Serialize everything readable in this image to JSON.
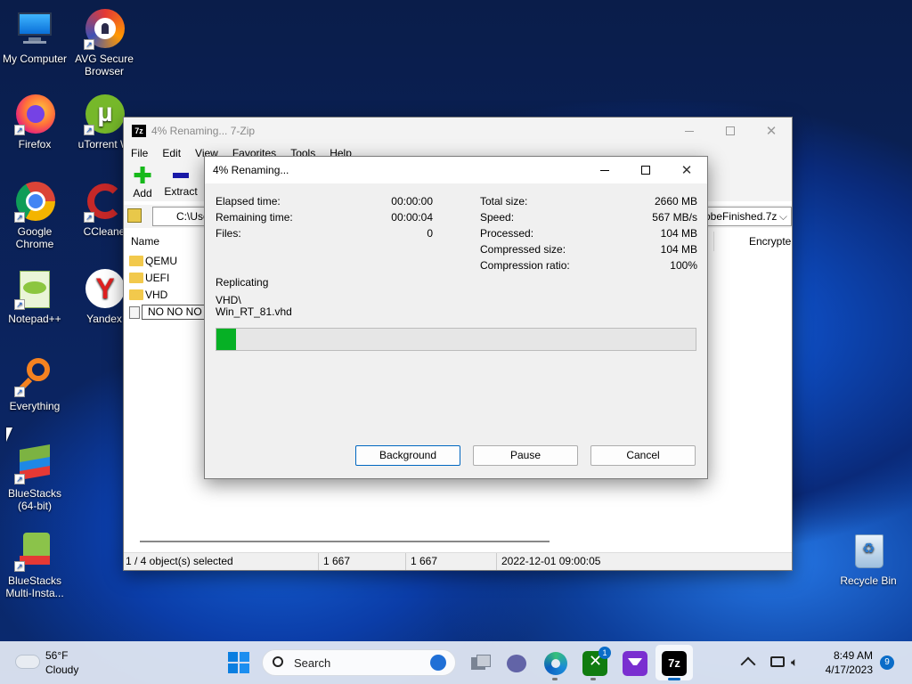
{
  "desktop": {
    "icons": [
      {
        "label": "My Computer",
        "icon": "computer-icon"
      },
      {
        "label": "AVG Secure Browser",
        "icon": "avg-browser-icon"
      },
      {
        "label": "Firefox",
        "icon": "firefox-icon"
      },
      {
        "label": "uTorrent W",
        "icon": "utorrent-icon"
      },
      {
        "label": "Google Chrome",
        "icon": "chrome-icon"
      },
      {
        "label": "CCleane",
        "icon": "ccleaner-icon"
      },
      {
        "label": "Notepad++",
        "icon": "notepadpp-icon"
      },
      {
        "label": "Yandex",
        "icon": "yandex-icon"
      },
      {
        "label": "Everything",
        "icon": "everything-icon"
      },
      {
        "label": "BlueStacks (64-bit)",
        "icon": "bluestacks-icon"
      },
      {
        "label": "BlueStacks Multi-Insta...",
        "icon": "bluestacks-multi-icon"
      },
      {
        "label": "Recycle Bin",
        "icon": "recycle-bin-icon"
      }
    ]
  },
  "zip": {
    "title": "4% Renaming... 7-Zip",
    "app_icon": "7z",
    "menu": [
      "File",
      "Edit",
      "View",
      "Favorites",
      "Tools",
      "Help"
    ],
    "toolbar": {
      "add": "Add",
      "extract": "Extract"
    },
    "path": "C:\\Use",
    "path_right": "obeFinished.7z",
    "columns": {
      "name": "Name",
      "encrypted": "Encrypte"
    },
    "files": [
      "QEMU",
      "UEFI",
      "VHD",
      "NO NO NO"
    ],
    "status": {
      "selected": "1 / 4 object(s) selected",
      "size1": "1 667",
      "size2": "1 667",
      "date": "2022-12-01 09:00:05"
    }
  },
  "progress": {
    "title": "4% Renaming...",
    "left": [
      {
        "label": "Elapsed time:",
        "value": "00:00:00"
      },
      {
        "label": "Remaining time:",
        "value": "00:00:04"
      },
      {
        "label": "Files:",
        "value": "0"
      }
    ],
    "right": [
      {
        "label": "Total size:",
        "value": "2660 MB"
      },
      {
        "label": "Speed:",
        "value": "567 MB/s"
      },
      {
        "label": "Processed:",
        "value": "104 MB"
      },
      {
        "label": "Compressed size:",
        "value": "104 MB"
      },
      {
        "label": "Compression ratio:",
        "value": "100%"
      }
    ],
    "operation": "Replicating",
    "path1": "VHD\\",
    "path2": "Win_RT_81.vhd",
    "percent": 4,
    "buttons": {
      "background": "Background",
      "pause": "Pause",
      "cancel": "Cancel"
    }
  },
  "taskbar": {
    "weather_temp": "56°F",
    "weather_desc": "Cloudy",
    "search": "Search",
    "time": "8:49 AM",
    "date": "4/17/2023",
    "notif_count": "9",
    "xbox_badge": "1",
    "zip_label": "7z"
  }
}
